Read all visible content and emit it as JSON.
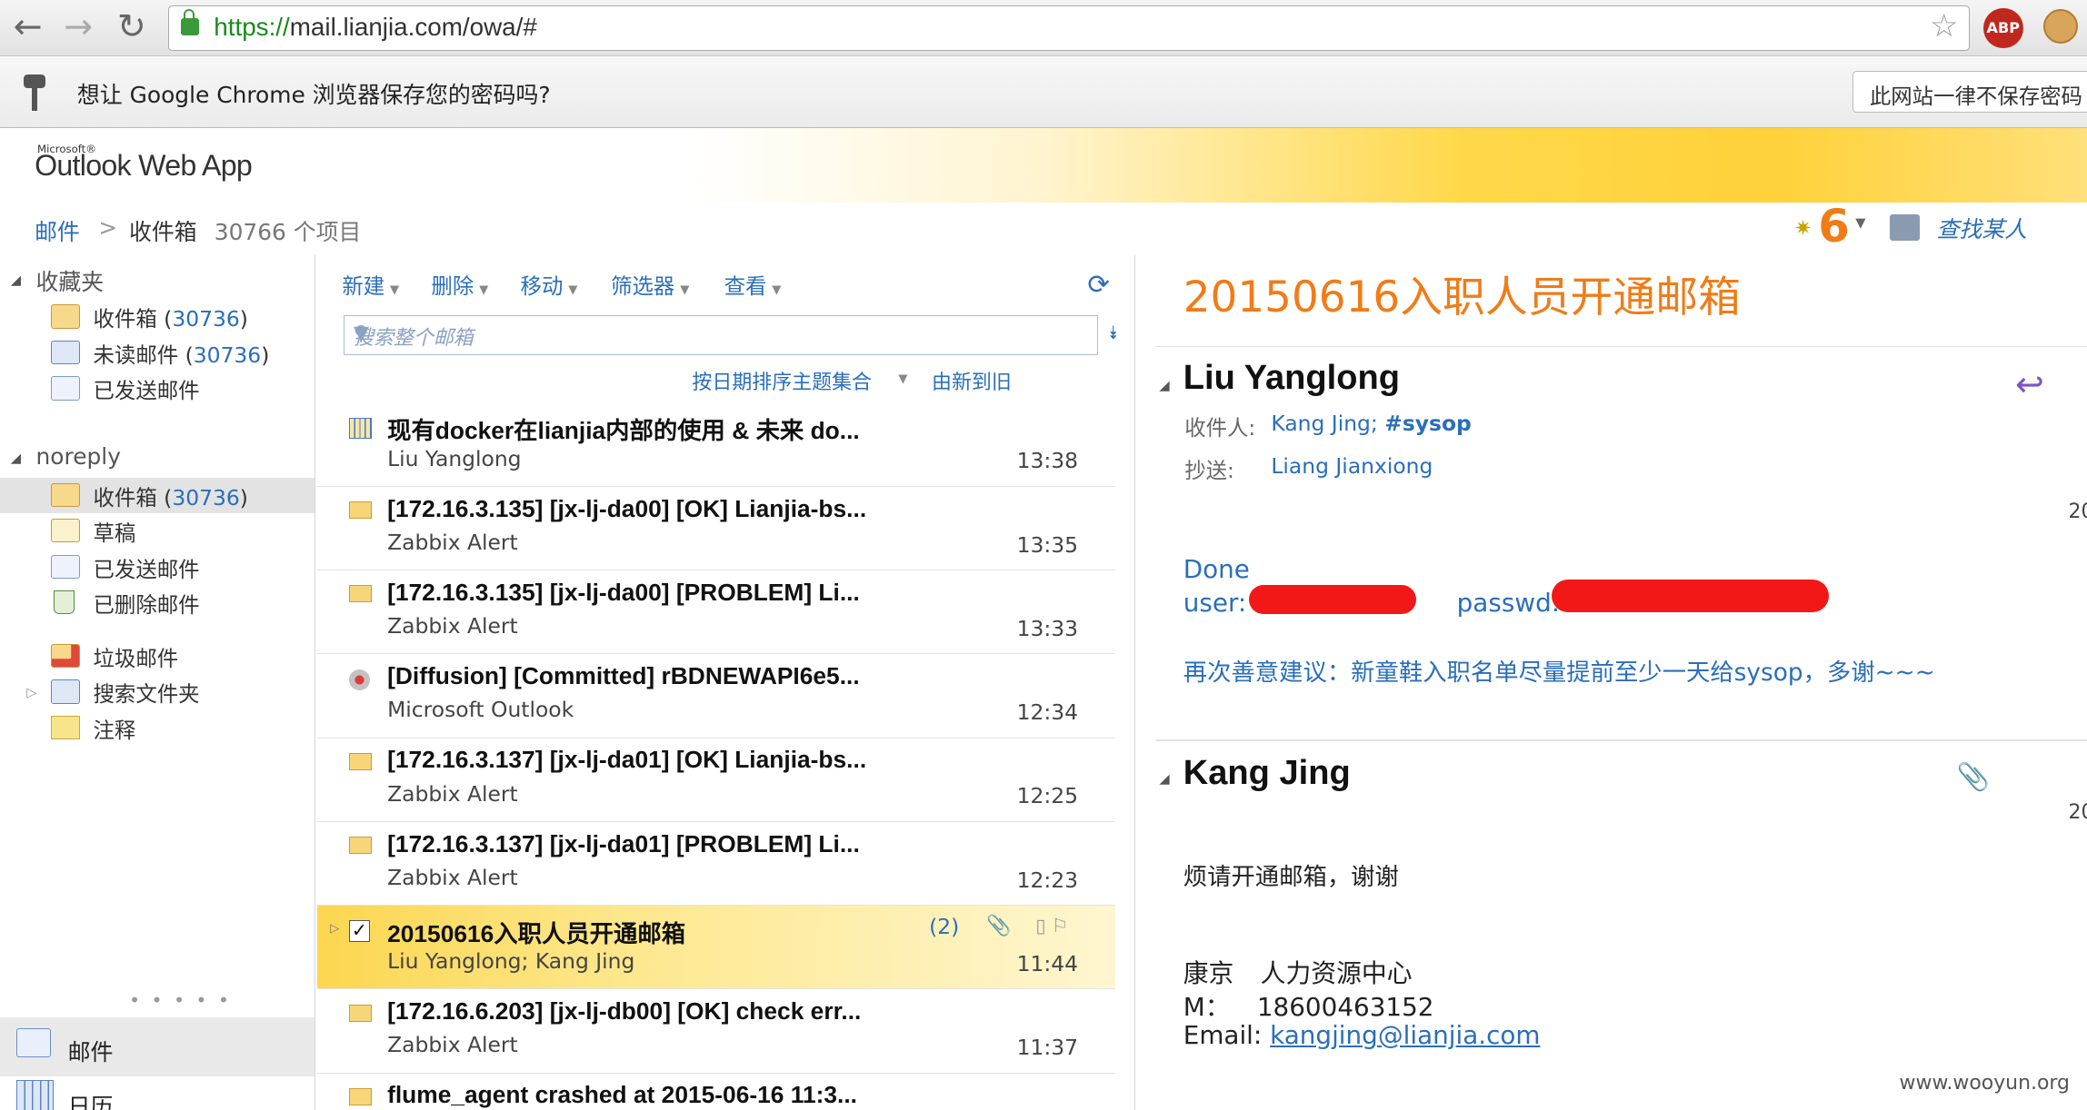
{
  "browser": {
    "url_scheme": "https://",
    "url_rest": "mail.lianjia.com/owa/#",
    "abp_label": "ABP",
    "infobar_text": "想让 Google Chrome 浏览器保存您的密码吗?",
    "infobar_button": "此网站一律不保存密码"
  },
  "app": {
    "ms_label": "Microsoft®",
    "logo": "Outlook Web App"
  },
  "breadcrumb": {
    "root": "邮件",
    "sep": ">",
    "folder": "收件箱",
    "count": "30766 个项目"
  },
  "header": {
    "notifications": "6",
    "find_people": "查找某人"
  },
  "nav": {
    "favorites_title": "收藏夹",
    "favorites": [
      {
        "label": "收件箱",
        "count": "30736"
      },
      {
        "label": "未读邮件",
        "count": "30736"
      },
      {
        "label": "已发送邮件",
        "count": ""
      }
    ],
    "account_title": "noreply",
    "folders": [
      {
        "label": "收件箱",
        "count": "30736"
      },
      {
        "label": "草稿",
        "count": ""
      },
      {
        "label": "已发送邮件",
        "count": ""
      },
      {
        "label": "已删除邮件",
        "count": ""
      },
      {
        "label": "垃圾邮件",
        "count": ""
      },
      {
        "label": "搜索文件夹",
        "count": ""
      },
      {
        "label": "注释",
        "count": ""
      }
    ],
    "dots": "• • • • •",
    "mail": "邮件",
    "calendar": "日历"
  },
  "toolbar": {
    "new": "新建",
    "delete": "删除",
    "move": "移动",
    "filter": "筛选器",
    "view": "查看"
  },
  "search": {
    "placeholder": "搜索整个邮箱"
  },
  "sort": {
    "by": "按日期排序主题集合",
    "order": "由新到旧"
  },
  "messages": [
    {
      "icon": "calendar",
      "subject": "现有docker在lianjia内部的使用 & 未来 do...",
      "from": "Liu Yanglong",
      "time": "13:38"
    },
    {
      "icon": "envelope",
      "subject": "[172.16.3.135] [jx-lj-da00] [OK] Lianjia-bs...",
      "from": "Zabbix Alert",
      "time": "13:35"
    },
    {
      "icon": "envelope",
      "subject": "[172.16.3.135] [jx-lj-da00] [PROBLEM] Li...",
      "from": "Zabbix Alert",
      "time": "13:33"
    },
    {
      "icon": "diffusion",
      "subject": "[Diffusion] [Committed] rBDNEWAPI6e5...",
      "from": "Microsoft Outlook",
      "time": "12:34"
    },
    {
      "icon": "envelope",
      "subject": "[172.16.3.137] [jx-lj-da01] [OK] Lianjia-bs...",
      "from": "Zabbix Alert",
      "time": "12:25"
    },
    {
      "icon": "envelope",
      "subject": "[172.16.3.137] [jx-lj-da01] [PROBLEM] Li...",
      "from": "Zabbix Alert",
      "time": "12:23"
    },
    {
      "icon": "checkbox",
      "subject": "20150616入职人员开通邮箱",
      "from": "Liu Yanglong; Kang Jing",
      "time": "11:44",
      "count": "(2)"
    },
    {
      "icon": "envelope",
      "subject": "[172.16.6.203] [jx-lj-db00] [OK] check err...",
      "from": "Zabbix Alert",
      "time": "11:37"
    },
    {
      "icon": "envelope",
      "subject": "flume_agent crashed at 2015-06-16 11:3...",
      "from": "",
      "time": ""
    }
  ],
  "reading": {
    "title": "20150616入职人员开通邮箱",
    "msg1": {
      "sender": "Liu Yanglong",
      "to_label": "收件人:",
      "to": "Kang Jing; ",
      "to_group": "#sysop",
      "cc_label": "抄送:",
      "cc": "Liang Jianxiong",
      "date_fragment": "20",
      "line1": "Done",
      "line2a": "user:",
      "line2b": "passwd:",
      "note": "再次善意建议：新童鞋入职名单尽量提前至少一天给sysop，多谢~~~"
    },
    "msg2": {
      "sender": "Kang Jing",
      "date_fragment": "20",
      "body": "烦请开通邮箱，谢谢",
      "sig_name_label": "康京",
      "sig_dept": "人力资源中心",
      "sig_m_label": "M：",
      "sig_phone": "18600463152",
      "sig_email_label": "Email:",
      "sig_email": "kangjing@lianjia.com"
    }
  },
  "watermark": "www.wooyun.org"
}
